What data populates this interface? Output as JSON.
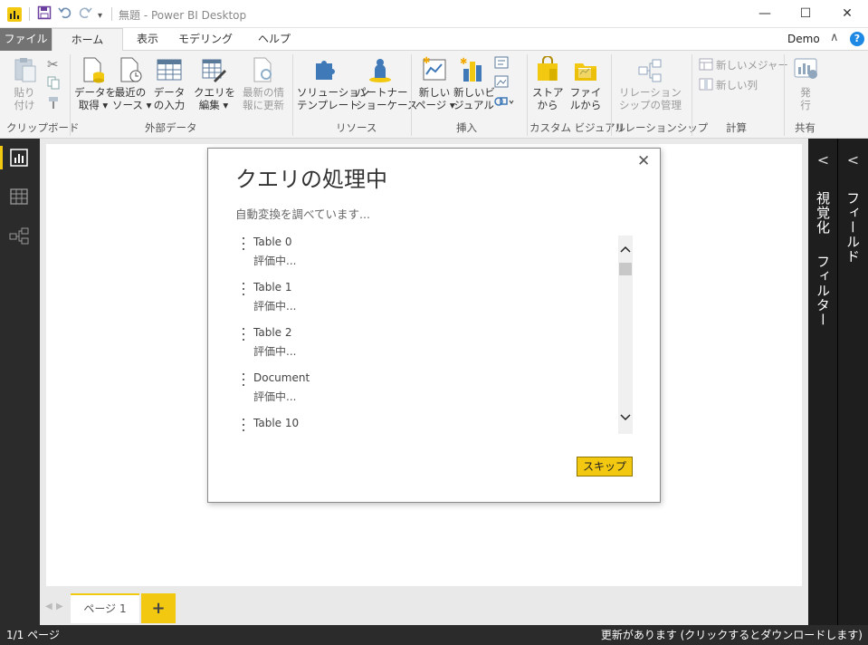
{
  "window": {
    "title": "無題 - Power BI Desktop",
    "minimize": "—",
    "maximize": "☐",
    "close": "✕"
  },
  "menu": {
    "file": "ファイル",
    "tabs": [
      "ホーム",
      "表示",
      "モデリング",
      "ヘルプ"
    ],
    "active_tab": "ホーム",
    "user": "Demo",
    "help": "?"
  },
  "ribbon": {
    "groups": [
      {
        "label": "クリップボード"
      },
      {
        "label": "外部データ"
      },
      {
        "label": "リソース"
      },
      {
        "label": "挿入"
      },
      {
        "label": "カスタム ビジュアル"
      },
      {
        "label": "リレーションシップ"
      },
      {
        "label": "計算"
      },
      {
        "label": "共有"
      }
    ],
    "buttons": {
      "paste": {
        "l1": "貼り",
        "l2": "付け"
      },
      "get_data": {
        "l1": "データを",
        "l2": "取得 ▾"
      },
      "recent_sources": {
        "l1": "最近の",
        "l2": "ソース ▾"
      },
      "enter_data": {
        "l1": "データ",
        "l2": "の入力"
      },
      "edit_queries": {
        "l1": "クエリを",
        "l2": "編集 ▾"
      },
      "refresh": {
        "l1": "最新の情",
        "l2": "報に更新"
      },
      "solution_templates": {
        "l1": "ソリューション",
        "l2": "テンプレート"
      },
      "partner_showcase": {
        "l1": "パートナー",
        "l2": "ショーケース"
      },
      "new_page": {
        "l1": "新しい",
        "l2": "ページ ▾"
      },
      "new_visual": {
        "l1": "新しいビ",
        "l2": "ジュアル"
      },
      "from_store": {
        "l1": "ストア",
        "l2": "から"
      },
      "from_file": {
        "l1": "ファイ",
        "l2": "ルから"
      },
      "manage_relationships": {
        "l1": "リレーション",
        "l2": "シップの管理"
      },
      "new_measure": "新しいメジャー",
      "new_column": "新しい列",
      "publish": {
        "l1": "発",
        "l2": "行"
      }
    }
  },
  "dialog": {
    "title": "クエリの処理中",
    "subtitle": "自動変換を調べています...",
    "queries": [
      {
        "name": "Table 0",
        "status": "評価中..."
      },
      {
        "name": "Table 1",
        "status": "評価中..."
      },
      {
        "name": "Table 2",
        "status": "評価中..."
      },
      {
        "name": "Document",
        "status": "評価中..."
      },
      {
        "name": "Table 10",
        "status": ""
      }
    ],
    "skip_label": "スキップ",
    "close": "✕"
  },
  "pages": {
    "tab_label": "ページ 1",
    "add_label": "+"
  },
  "panes": {
    "visualizations": "視覚化",
    "filters": "フィルター",
    "fields": "フィールド"
  },
  "status": {
    "page_count": "1/1 ページ",
    "update_notice": "更新があります (クリックするとダウンロードします)"
  },
  "colors": {
    "accent": "#f2c811",
    "dark_chrome": "#2b2b2b"
  }
}
